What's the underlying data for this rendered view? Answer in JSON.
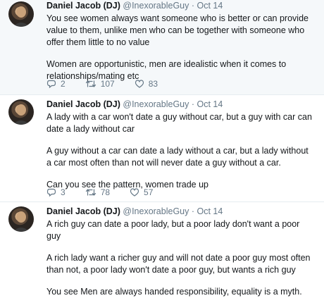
{
  "tweets": [
    {
      "name": "Daniel Jacob (DJ)",
      "handle": "@InexorableGuy",
      "sep": "·",
      "time": "Oct 14",
      "paragraphs": [
        "You see women always want someone who is better or can provide value to them, unlike men who can be together with someone who offer them little to no value",
        "Women are opportunistic, men are idealistic when it comes to relationships/mating etc"
      ],
      "replies": "2",
      "retweets": "107",
      "likes": "83"
    },
    {
      "name": "Daniel Jacob (DJ)",
      "handle": "@InexorableGuy",
      "sep": "·",
      "time": "Oct 14",
      "paragraphs": [
        "A lady with a car won't date a guy without car, but a guy with car can date a lady without car",
        "A guy without a car can date a lady without a car, but a lady without a car most often than not will never date a guy without a car.",
        "Can you see the pattern, women trade up"
      ],
      "replies": "3",
      "retweets": "78",
      "likes": "57"
    },
    {
      "name": "Daniel Jacob (DJ)",
      "handle": "@InexorableGuy",
      "sep": "·",
      "time": "Oct 14",
      "paragraphs": [
        "A rich guy can date a poor lady, but a poor lady don't want a poor guy",
        "A rich lady want a richer guy and will not date a poor guy most often than not, a poor lady won't date a poor guy, but wants a rich guy",
        "You see Men are always handed responsibility, equality is a myth."
      ]
    }
  ],
  "icons": {
    "reply": "reply-icon",
    "retweet": "retweet-icon",
    "like": "heart-icon"
  },
  "colors": {
    "name": "#14171a",
    "muted": "#657786",
    "highlight_bg": "#f5f8fa",
    "divider": "#e6ecf0"
  }
}
